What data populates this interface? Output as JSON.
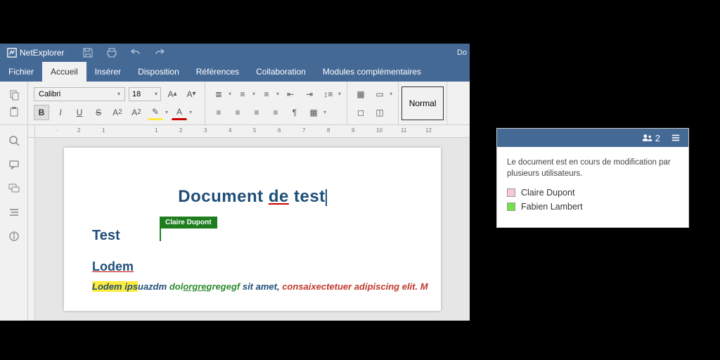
{
  "app": {
    "name": "NetExplorer",
    "doc_partial": "Do"
  },
  "menu": {
    "file": "Fichier",
    "home": "Accueil",
    "insert": "Insérer",
    "layout": "Disposition",
    "refs": "Références",
    "collab": "Collaboration",
    "plugins": "Modules complémentaires"
  },
  "ribbon": {
    "font_name": "Calibri",
    "font_size": "18",
    "style_normal": "Normal"
  },
  "ruler": {
    "ticks": [
      "2",
      "1",
      "",
      "1",
      "2",
      "3",
      "4",
      "5",
      "6",
      "7",
      "8",
      "9",
      "10",
      "11",
      "12"
    ]
  },
  "document": {
    "title_pre": "Document ",
    "title_ul": "de",
    "title_post": " test",
    "test": "Test",
    "lodem_heading": "Lodem",
    "para_hl": "Lodem ips",
    "para_blue1": "uazdm ",
    "para_green1": "dol",
    "para_green_ul": "orgre",
    "para_green2": "gregegf ",
    "para_blue2": "sit amet, ",
    "para_red": "consaixectetuer adipiscing elit. M"
  },
  "collab_cursor": {
    "name": "Claire Dupont"
  },
  "panel": {
    "count": "2",
    "message": "Le document est en cours de modification par plusieurs utilisateurs.",
    "users": [
      {
        "name": "Claire Dupont",
        "color": "#f6c7d8"
      },
      {
        "name": "Fabien Lambert",
        "color": "#6fe24a"
      }
    ]
  }
}
